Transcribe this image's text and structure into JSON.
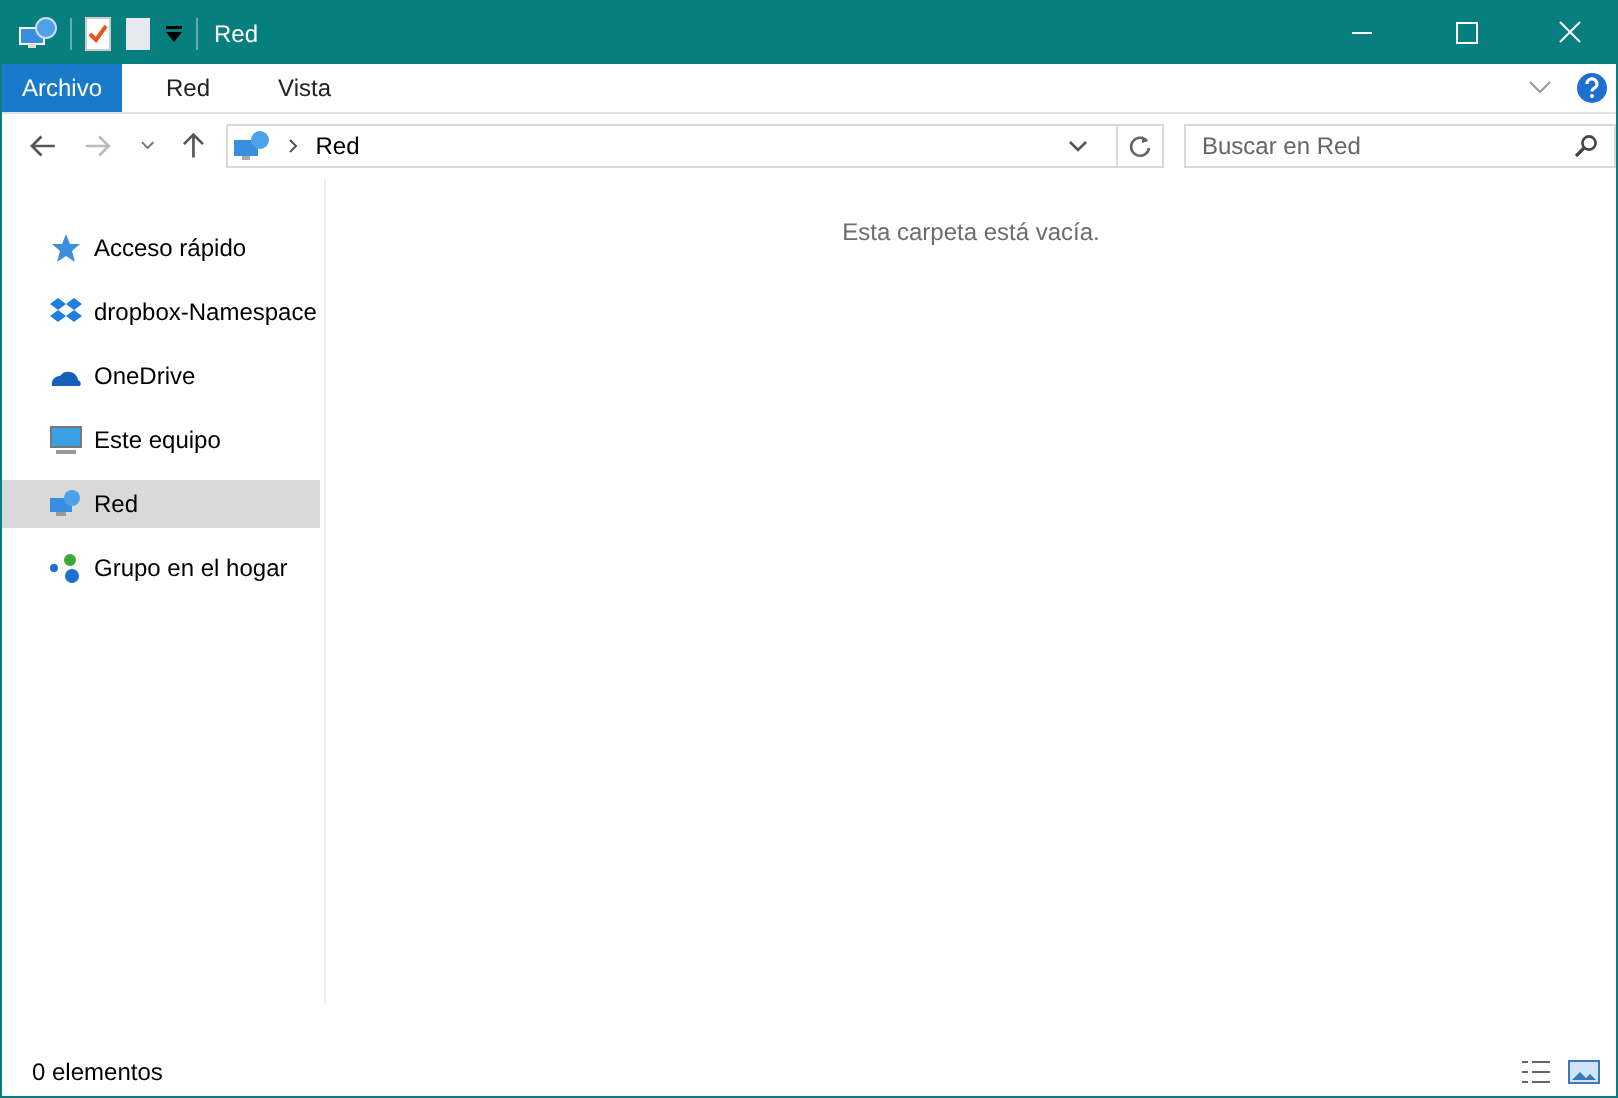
{
  "window": {
    "title": "Red"
  },
  "ribbon_tabs": [
    {
      "label": "Archivo",
      "kind": "file"
    },
    {
      "label": "Red",
      "kind": "tab"
    },
    {
      "label": "Vista",
      "kind": "tab"
    }
  ],
  "address": {
    "path": "Red"
  },
  "search": {
    "placeholder": "Buscar en Red"
  },
  "sidebar": {
    "items": [
      {
        "label": "Acceso rápido",
        "kind": "star",
        "selected": false
      },
      {
        "label": "dropbox-Namespace",
        "kind": "dropbox",
        "selected": false
      },
      {
        "label": "OneDrive",
        "kind": "cloud",
        "selected": false
      },
      {
        "label": "Este equipo",
        "kind": "computer",
        "selected": false
      },
      {
        "label": "Red",
        "kind": "network",
        "selected": true
      },
      {
        "label": "Grupo en el hogar",
        "kind": "homegroup",
        "selected": false
      }
    ]
  },
  "content": {
    "empty_message": "Esta carpeta está vacía."
  },
  "status_bar": {
    "count": "0 elementos"
  }
}
